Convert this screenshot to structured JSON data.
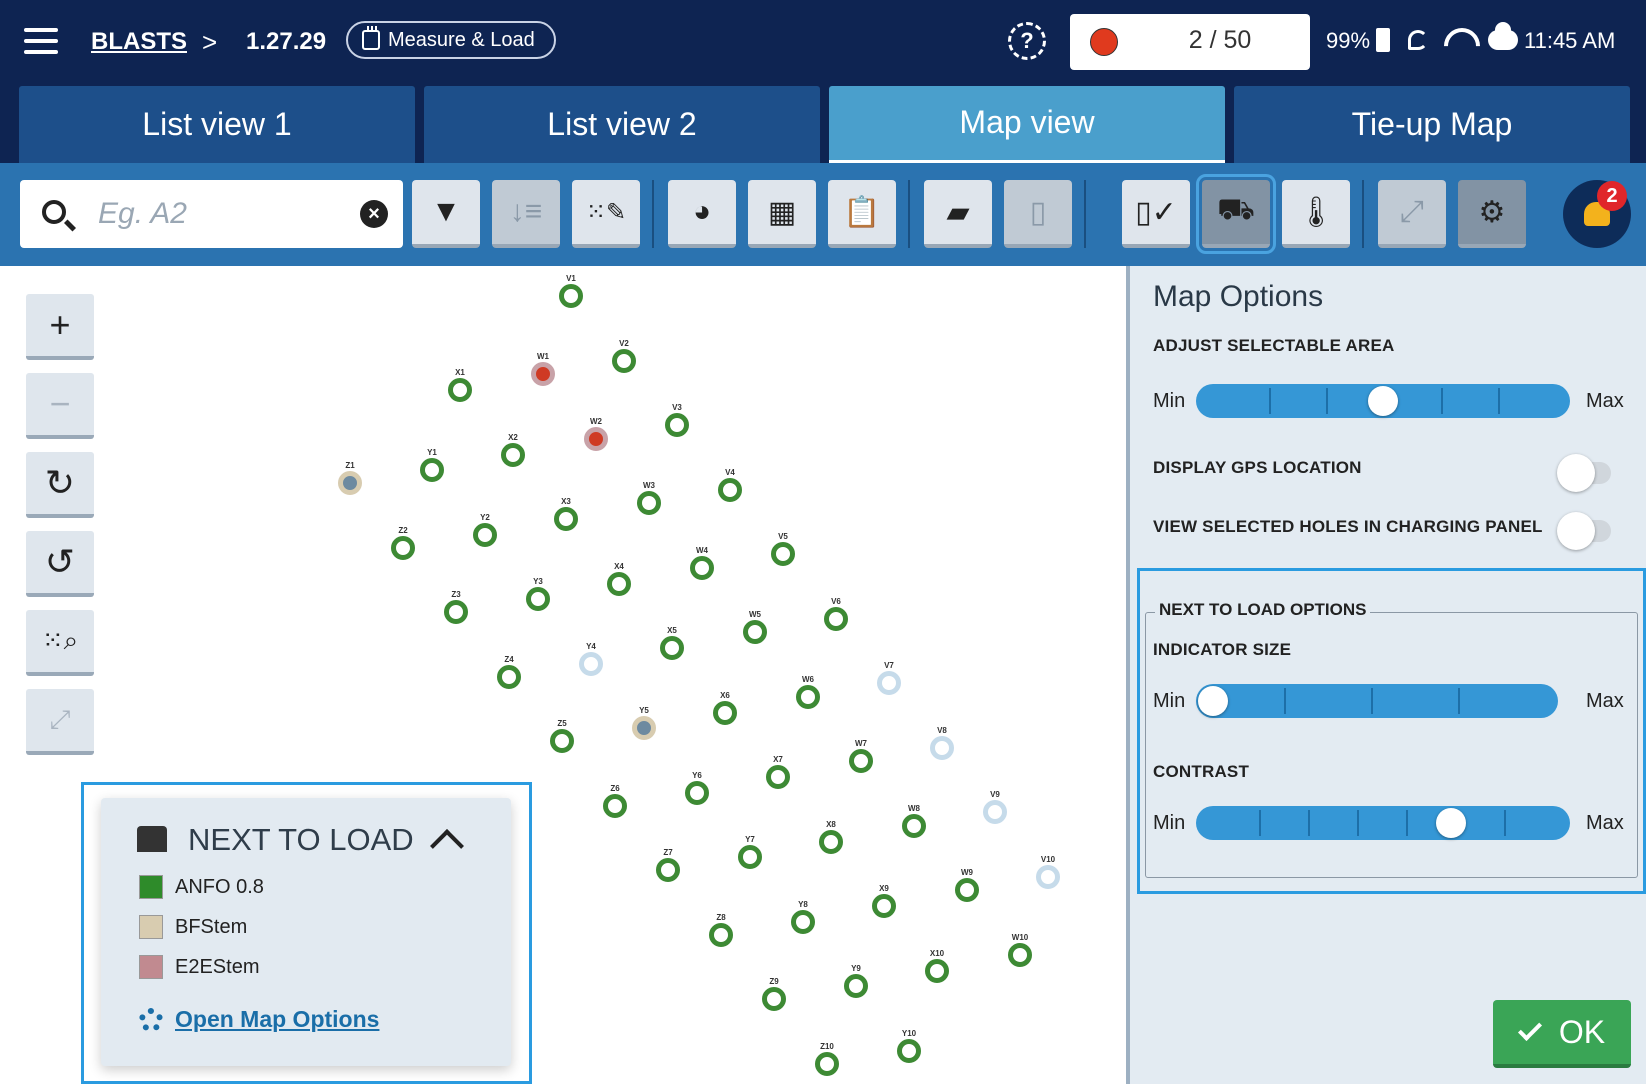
{
  "header": {
    "breadcrumb": {
      "root": "BLASTS",
      "separator": ">",
      "version": "1.27.29"
    },
    "mode_label": "Measure & Load",
    "counter": "2 / 50",
    "battery": "99%",
    "time": "11:45 AM"
  },
  "tabs": [
    {
      "label": "List view 1",
      "active": false
    },
    {
      "label": "List view 2",
      "active": false
    },
    {
      "label": "Map view",
      "active": true
    },
    {
      "label": "Tie-up Map",
      "active": false
    }
  ],
  "search": {
    "placeholder": "Eg. A2",
    "value": ""
  },
  "toolbar": {
    "buttons": [
      "filter-icon",
      "sort-icon",
      "edit-pattern-icon",
      "shovel-icon",
      "grid-icon",
      "clipboard-icon",
      "folder-open-icon",
      "document-view-icon",
      "charge-check-icon",
      "truck-icon",
      "thermometer-icon",
      "tie-icon",
      "gear-icon"
    ],
    "notification_count": "2"
  },
  "map": {
    "holes": [
      {
        "id": "V1",
        "type": "anfo"
      },
      {
        "id": "V2",
        "type": "anfo"
      },
      {
        "id": "V3",
        "type": "anfo"
      },
      {
        "id": "V4",
        "type": "anfo"
      },
      {
        "id": "V5",
        "type": "anfo"
      },
      {
        "id": "V6",
        "type": "anfo"
      },
      {
        "id": "V7",
        "type": "pale"
      },
      {
        "id": "V8",
        "type": "pale"
      },
      {
        "id": "V9",
        "type": "pale"
      },
      {
        "id": "V10",
        "type": "pale"
      },
      {
        "id": "W1",
        "type": "e2e"
      },
      {
        "id": "W2",
        "type": "e2e"
      },
      {
        "id": "W3",
        "type": "anfo"
      },
      {
        "id": "W4",
        "type": "anfo"
      },
      {
        "id": "W5",
        "type": "anfo"
      },
      {
        "id": "W6",
        "type": "anfo"
      },
      {
        "id": "W7",
        "type": "anfo"
      },
      {
        "id": "W8",
        "type": "anfo"
      },
      {
        "id": "W9",
        "type": "anfo"
      },
      {
        "id": "W10",
        "type": "anfo"
      },
      {
        "id": "X1",
        "type": "anfo"
      },
      {
        "id": "X2",
        "type": "anfo"
      },
      {
        "id": "X3",
        "type": "anfo"
      },
      {
        "id": "X4",
        "type": "anfo"
      },
      {
        "id": "X5",
        "type": "anfo"
      },
      {
        "id": "X6",
        "type": "anfo"
      },
      {
        "id": "X7",
        "type": "anfo"
      },
      {
        "id": "X8",
        "type": "anfo"
      },
      {
        "id": "X9",
        "type": "anfo"
      },
      {
        "id": "X10",
        "type": "anfo"
      },
      {
        "id": "Y1",
        "type": "anfo"
      },
      {
        "id": "Y2",
        "type": "anfo"
      },
      {
        "id": "Y3",
        "type": "anfo"
      },
      {
        "id": "Y4",
        "type": "pale"
      },
      {
        "id": "Y5",
        "type": "bf"
      },
      {
        "id": "Y6",
        "type": "anfo"
      },
      {
        "id": "Y7",
        "type": "anfo"
      },
      {
        "id": "Y8",
        "type": "anfo"
      },
      {
        "id": "Y9",
        "type": "anfo"
      },
      {
        "id": "Y10",
        "type": "anfo"
      },
      {
        "id": "Z1",
        "type": "bf"
      },
      {
        "id": "Z2",
        "type": "anfo"
      },
      {
        "id": "Z3",
        "type": "anfo"
      },
      {
        "id": "Z4",
        "type": "anfo"
      },
      {
        "id": "Z5",
        "type": "anfo"
      },
      {
        "id": "Z6",
        "type": "anfo"
      },
      {
        "id": "Z7",
        "type": "anfo"
      },
      {
        "id": "Z8",
        "type": "anfo"
      },
      {
        "id": "Z9",
        "type": "anfo"
      },
      {
        "id": "Z10",
        "type": "anfo"
      }
    ]
  },
  "legend": {
    "title": "NEXT TO LOAD",
    "items": [
      {
        "label": "ANFO 0.8",
        "color": "#2e8b2a"
      },
      {
        "label": "BFStem",
        "color": "#d8ccb0"
      },
      {
        "label": "E2EStem",
        "color": "#c18a90"
      }
    ],
    "link": "Open Map Options"
  },
  "panel": {
    "title": "Map Options",
    "adjust_area": {
      "label": "ADJUST SELECTABLE AREA",
      "min": "Min",
      "max": "Max",
      "level": 0.5
    },
    "gps": {
      "label": "DISPLAY GPS LOCATION",
      "on": false
    },
    "view_selected": {
      "label": "VIEW SELECTED HOLES IN CHARGING PANEL",
      "on": false
    },
    "ntl": {
      "title": "NEXT TO LOAD OPTIONS",
      "indicator_size": {
        "label": "INDICATOR SIZE",
        "min": "Min",
        "max": "Max",
        "level": 0.0
      },
      "contrast": {
        "label": "CONTRAST",
        "min": "Min",
        "max": "Max",
        "level": 0.7
      }
    },
    "ok_label": "OK"
  }
}
